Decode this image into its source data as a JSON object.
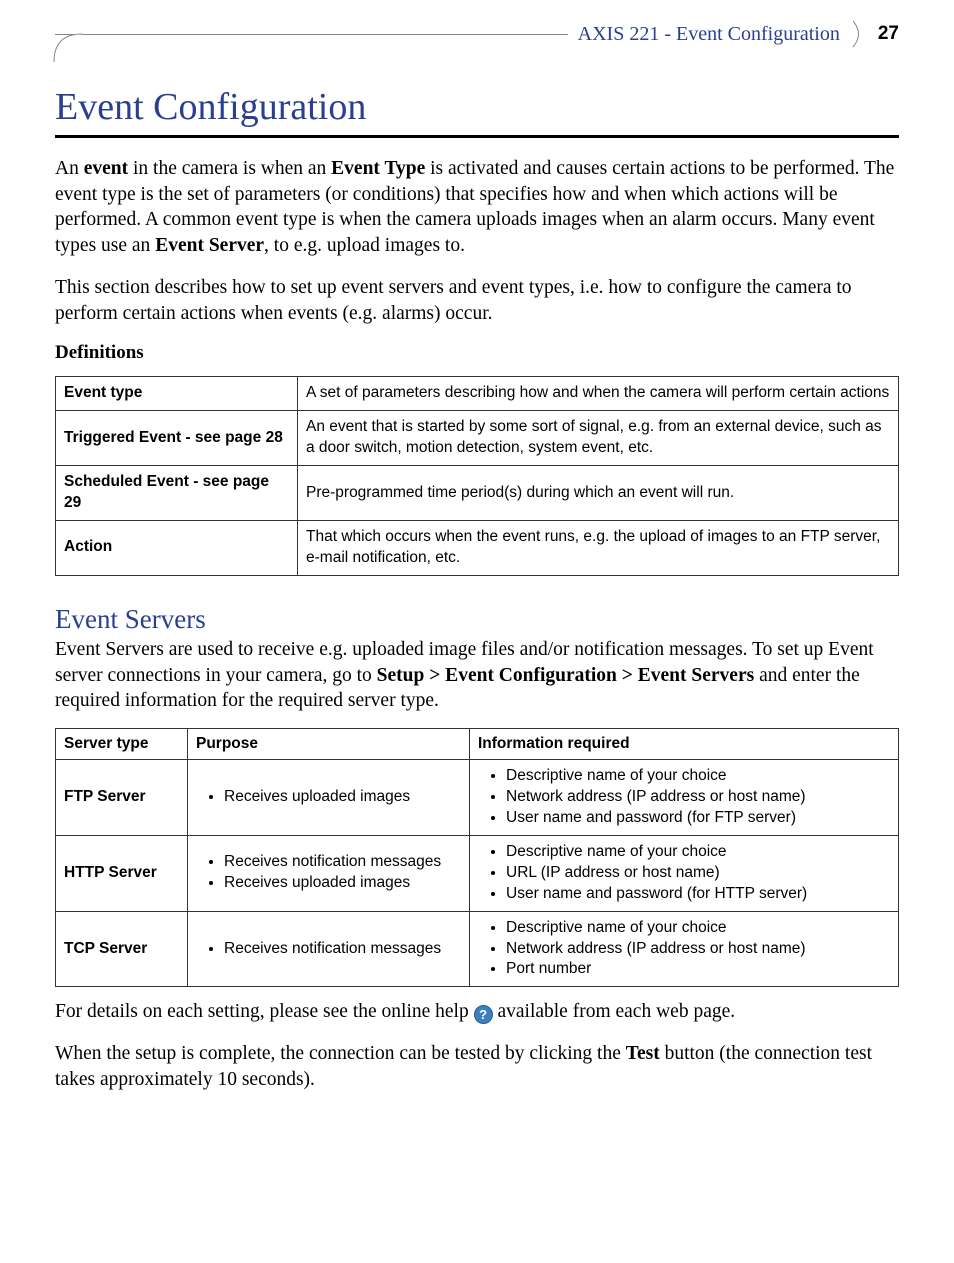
{
  "header": {
    "breadcrumb": "AXIS 221 - Event Configuration",
    "page_number": "27"
  },
  "h1": "Event Configuration",
  "intro": {
    "p1_pre": "An ",
    "p1_b1": "event",
    "p1_mid1": " in the camera is when an ",
    "p1_b2": "Event Type",
    "p1_mid2": " is activated and causes certain actions to be performed. The event type is the set of parameters (or conditions) that specifies how and when which actions will be performed. A common event type is when the camera uploads images when an alarm occurs. Many event types use an ",
    "p1_b3": "Event Server",
    "p1_post": ", to e.g. upload images to.",
    "p2": "This section describes how to set up event servers and event types, i.e. how to configure the camera to perform certain actions when events (e.g. alarms) occur."
  },
  "definitions": {
    "heading": "Definitions",
    "rows": [
      {
        "term": "Event type",
        "def": "A set of parameters describing how and when the camera will perform certain actions"
      },
      {
        "term": "Triggered Event - see page 28",
        "def": "An event that is started by some sort of signal, e.g. from an external device, such as a door switch, motion detection, system event, etc."
      },
      {
        "term": "Scheduled Event - see page 29",
        "def": "Pre-programmed time period(s) during which an event will run."
      },
      {
        "term": "Action",
        "def": "That which occurs when the event runs, e.g. the upload of images to an FTP server, e-mail notification, etc."
      }
    ]
  },
  "event_servers": {
    "heading": "Event Servers",
    "p1_pre": "Event Servers are used to receive e.g. uploaded image files and/or notification messages. To set up Event server connections in your camera, go to ",
    "p1_b1": "Setup > Event Configuration > Event Servers",
    "p1_post": " and enter the required information for the required server type.",
    "table": {
      "headers": {
        "c1": "Server type",
        "c2": "Purpose",
        "c3": "Information required"
      },
      "rows": [
        {
          "type": "FTP Server",
          "purpose": [
            "Receives uploaded images"
          ],
          "info": [
            "Descriptive name of your choice",
            "Network address (IP address or host name)",
            "User name and password (for FTP server)"
          ]
        },
        {
          "type": "HTTP Server",
          "purpose": [
            "Receives notification messages",
            "Receives uploaded images"
          ],
          "info": [
            "Descriptive name of your choice",
            "URL (IP address or host name)",
            "User name and password (for HTTP server)"
          ]
        },
        {
          "type": "TCP Server",
          "purpose": [
            "Receives notification messages"
          ],
          "info": [
            "Descriptive name of your choice",
            "Network address (IP address or host name)",
            "Port number"
          ]
        }
      ]
    },
    "p2_pre": "For details on each setting, please see the online help ",
    "p2_icon": "?",
    "p2_post": " available from each web page.",
    "p3_pre": "When the setup is complete, the connection can be tested by clicking the ",
    "p3_b1": "Test",
    "p3_post": " button (the connection test takes approximately 10 seconds)."
  }
}
